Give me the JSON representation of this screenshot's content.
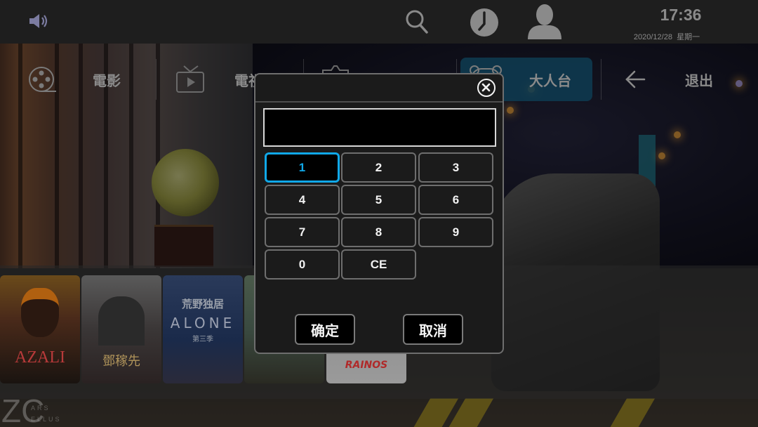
{
  "status_bar": {
    "time": "17:36",
    "date": "2020/12/28",
    "weekday": "星期一",
    "icons": [
      "volume-icon",
      "search-icon",
      "history-icon",
      "user-icon"
    ]
  },
  "nav": {
    "items": [
      {
        "label": "電影",
        "icon": "film-reel-icon",
        "active": false
      },
      {
        "label": "電視劇",
        "icon": "tv-play-icon",
        "active": false,
        "partially_hidden": true
      },
      {
        "label": "",
        "icon": "bag-icon",
        "active": false,
        "partially_hidden": true
      },
      {
        "label": "大人台",
        "icon": "bear-icon",
        "active": true
      },
      {
        "label": "退出",
        "icon": "back-arrow-icon",
        "active": false
      }
    ],
    "active_color": "#0e3c52"
  },
  "posters": [
    {
      "title": "AZALI",
      "top_text": "",
      "subtitle": ""
    },
    {
      "title": "鄧稼先",
      "top_text": "",
      "subtitle": ""
    },
    {
      "title": "ALONE",
      "top_text": "荒野独居",
      "subtitle": "第三季"
    },
    {
      "title": "",
      "top_text": "",
      "subtitle": ""
    },
    {
      "title": "RAINOS",
      "top_text": "",
      "subtitle": ""
    }
  ],
  "logo": {
    "letters": "ZC",
    "line1": "ARS",
    "line2": "ELLUS"
  },
  "pin_dialog": {
    "close_icon": "close-circle-icon",
    "input_value": "",
    "keys": [
      "1",
      "2",
      "3",
      "4",
      "5",
      "6",
      "7",
      "8",
      "9",
      "0",
      "CE"
    ],
    "focused_key": "1",
    "confirm_label": "确定",
    "cancel_label": "取消",
    "focus_color": "#10a8e8"
  }
}
